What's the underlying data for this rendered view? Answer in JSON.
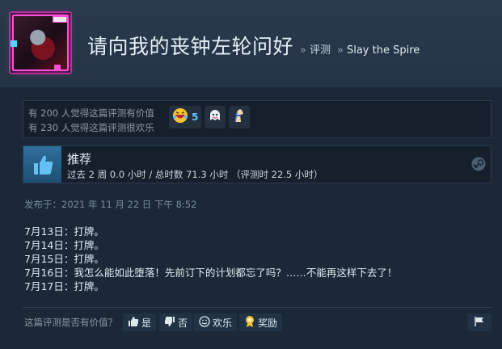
{
  "header": {
    "review_title": "请向我的丧钟左轮问好",
    "breadcrumb": [
      {
        "label": "评测"
      },
      {
        "label": "Slay the Spire"
      }
    ],
    "separator": "»"
  },
  "votes": {
    "helpful_text": "有 200 人觉得这篇评测有价值",
    "funny_text": "有 230 人觉得这篇评测很欢乐",
    "awards": [
      {
        "icon": "laughing-face-icon",
        "count": "5"
      },
      {
        "icon": "ghost-face-icon",
        "count": ""
      },
      {
        "icon": "flex-arm-icon",
        "count": ""
      }
    ]
  },
  "recommendation": {
    "label": "推荐",
    "hours": "过去 2 周 0.0 小时 / 总时数 71.3 小时 （评测时 22.5 小时）",
    "icon": "thumbs-up-icon"
  },
  "posted": "发布于：2021 年 11 月 22 日 下午 8:52",
  "body": {
    "lines": [
      "7月13日：打牌。",
      "7月14日：打牌。",
      "7月15日：打牌。",
      "7月16日：我怎么能如此堕落！先前订下的计划都忘了吗？……不能再这样下去了！",
      "7月17日：打牌。"
    ]
  },
  "footer": {
    "helpful_question": "这篇评测是否有价值？",
    "yes_label": "是",
    "no_label": "否",
    "funny_label": "欢乐",
    "award_label": "奖励"
  },
  "colors": {
    "background": "#1b2838",
    "accent": "#67c1f5",
    "text": "#c6d4df"
  }
}
